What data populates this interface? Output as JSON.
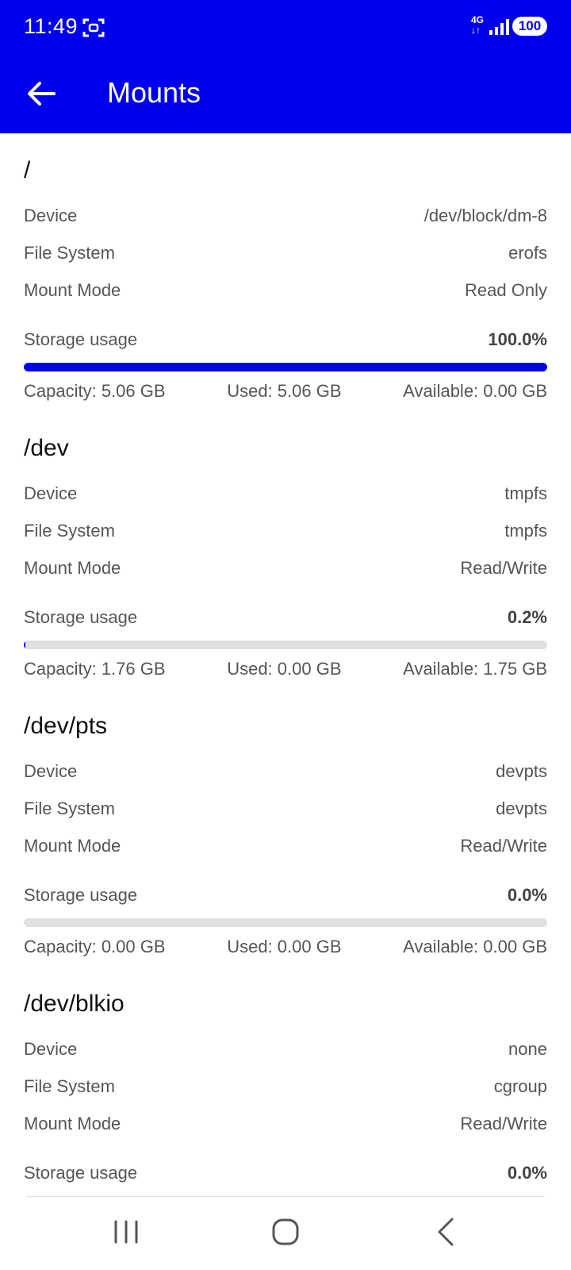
{
  "status_bar": {
    "time": "11:49",
    "network": "4G",
    "net_arrows": "↓↑",
    "battery": "100"
  },
  "toolbar": {
    "title": "Mounts"
  },
  "colors": {
    "accent": "#0000ee",
    "track": "#e0e0e0",
    "text_secondary": "#555555"
  },
  "labels": {
    "device": "Device",
    "file_system": "File System",
    "mount_mode": "Mount Mode",
    "storage_usage": "Storage usage"
  },
  "mounts": [
    {
      "path": "/",
      "device": "/dev/block/dm-8",
      "file_system": "erofs",
      "mount_mode": "Read Only",
      "usage_percent": "100.0%",
      "usage_fraction": 1.0,
      "capacity": "Capacity: 5.06 GB",
      "used": "Used: 5.06 GB",
      "available": "Available: 0.00 GB"
    },
    {
      "path": "/dev",
      "device": "tmpfs",
      "file_system": "tmpfs",
      "mount_mode": "Read/Write",
      "usage_percent": "0.2%",
      "usage_fraction": 0.002,
      "capacity": "Capacity: 1.76 GB",
      "used": "Used: 0.00 GB",
      "available": "Available: 1.75 GB"
    },
    {
      "path": "/dev/pts",
      "device": "devpts",
      "file_system": "devpts",
      "mount_mode": "Read/Write",
      "usage_percent": "0.0%",
      "usage_fraction": 0.0,
      "capacity": "Capacity: 0.00 GB",
      "used": "Used: 0.00 GB",
      "available": "Available: 0.00 GB"
    },
    {
      "path": "/dev/blkio",
      "device": "none",
      "file_system": "cgroup",
      "mount_mode": "Read/Write",
      "usage_percent": "0.0%",
      "usage_fraction": 0.0
    }
  ]
}
